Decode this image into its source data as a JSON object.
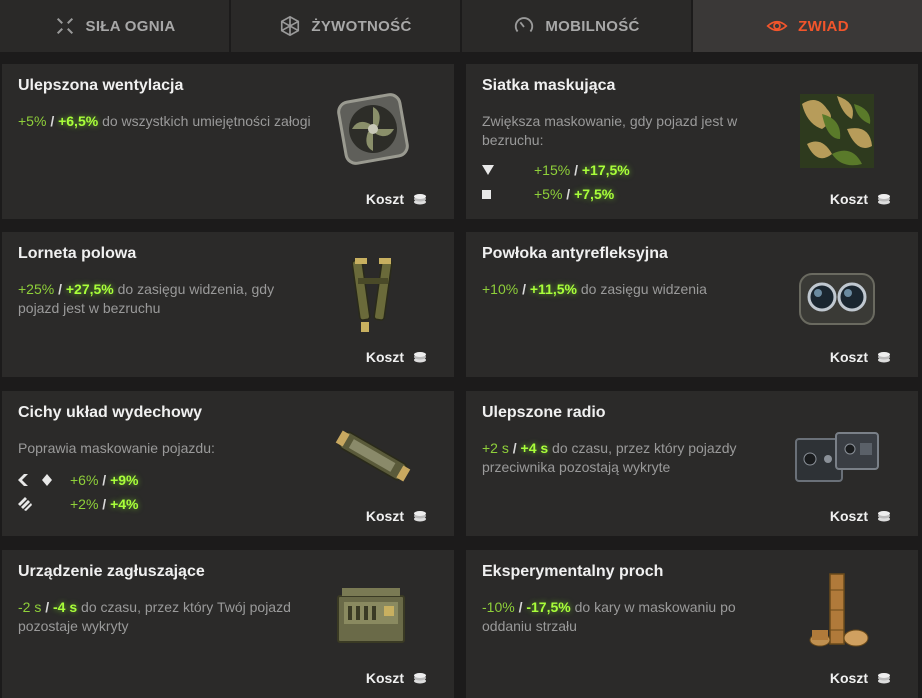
{
  "tabs": [
    {
      "label": "SIŁA OGNIA",
      "icon": "crosshair-icon"
    },
    {
      "label": "ŻYWOTNOŚĆ",
      "icon": "hexagon-icon"
    },
    {
      "label": "MOBILNOŚĆ",
      "icon": "speedometer-icon"
    },
    {
      "label": "ZWIAD",
      "icon": "eye-icon",
      "active": true
    }
  ],
  "cost_label": "Koszt",
  "cards": [
    {
      "title": "Ulepszona wentylacja",
      "v1": "+5%",
      "v2": "+6,5%",
      "rest": " do wszystkich umiejętności załogi",
      "icon": "ventilation-fan-icon"
    },
    {
      "title": "Siatka maskująca",
      "desc": "Zwiększa maskowanie, gdy pojazd jest w bezruchu:",
      "rows": [
        {
          "icon": "triangle-down-icon",
          "v1": "+15%",
          "v2": "+17,5%"
        },
        {
          "icon": "square-icon",
          "v1": "+5%",
          "v2": "+7,5%"
        }
      ],
      "icon": "camouflage-net-icon"
    },
    {
      "title": "Lorneta polowa",
      "v1": "+25%",
      "v2": "+27,5%",
      "rest": " do zasięgu widzenia, gdy pojazd jest w bezruchu",
      "icon": "binocular-periscope-icon"
    },
    {
      "title": "Powłoka antyrefleksyjna",
      "v1": "+10%",
      "v2": "+11,5%",
      "rest": " do zasięgu widzenia",
      "icon": "optics-goggles-icon"
    },
    {
      "title": "Cichy układ wydechowy",
      "desc": "Poprawia maskowanie pojazdu:",
      "rows": [
        {
          "icon": "light-medium-tank-icon",
          "v1": "+6%",
          "v2": "+9%"
        },
        {
          "icon": "tank-destroyer-icon",
          "v1": "+2%",
          "v2": "+4%"
        }
      ],
      "icon": "exhaust-muffler-icon"
    },
    {
      "title": "Ulepszone radio",
      "v1": "+2 s",
      "v2": "+4 s",
      "rest": " do czasu, przez który pojazdy przeciwnika pozostają wykryte",
      "icon": "radio-set-icon"
    },
    {
      "title": "Urządzenie zagłuszające",
      "v1": "-2 s",
      "v2": "-4 s",
      "rest": " do czasu, przez który Twój pojazd pozostaje wykryty",
      "icon": "jammer-box-icon"
    },
    {
      "title": "Eksperymentalny proch",
      "v1": "-10%",
      "v2": "-17,5%",
      "rest": " do kary w maskowaniu po oddaniu strzału",
      "icon": "powder-charges-icon"
    }
  ],
  "colors": {
    "accent": "#f2552b",
    "green": "#8fd03a",
    "green_bright": "#a9ff3a"
  }
}
